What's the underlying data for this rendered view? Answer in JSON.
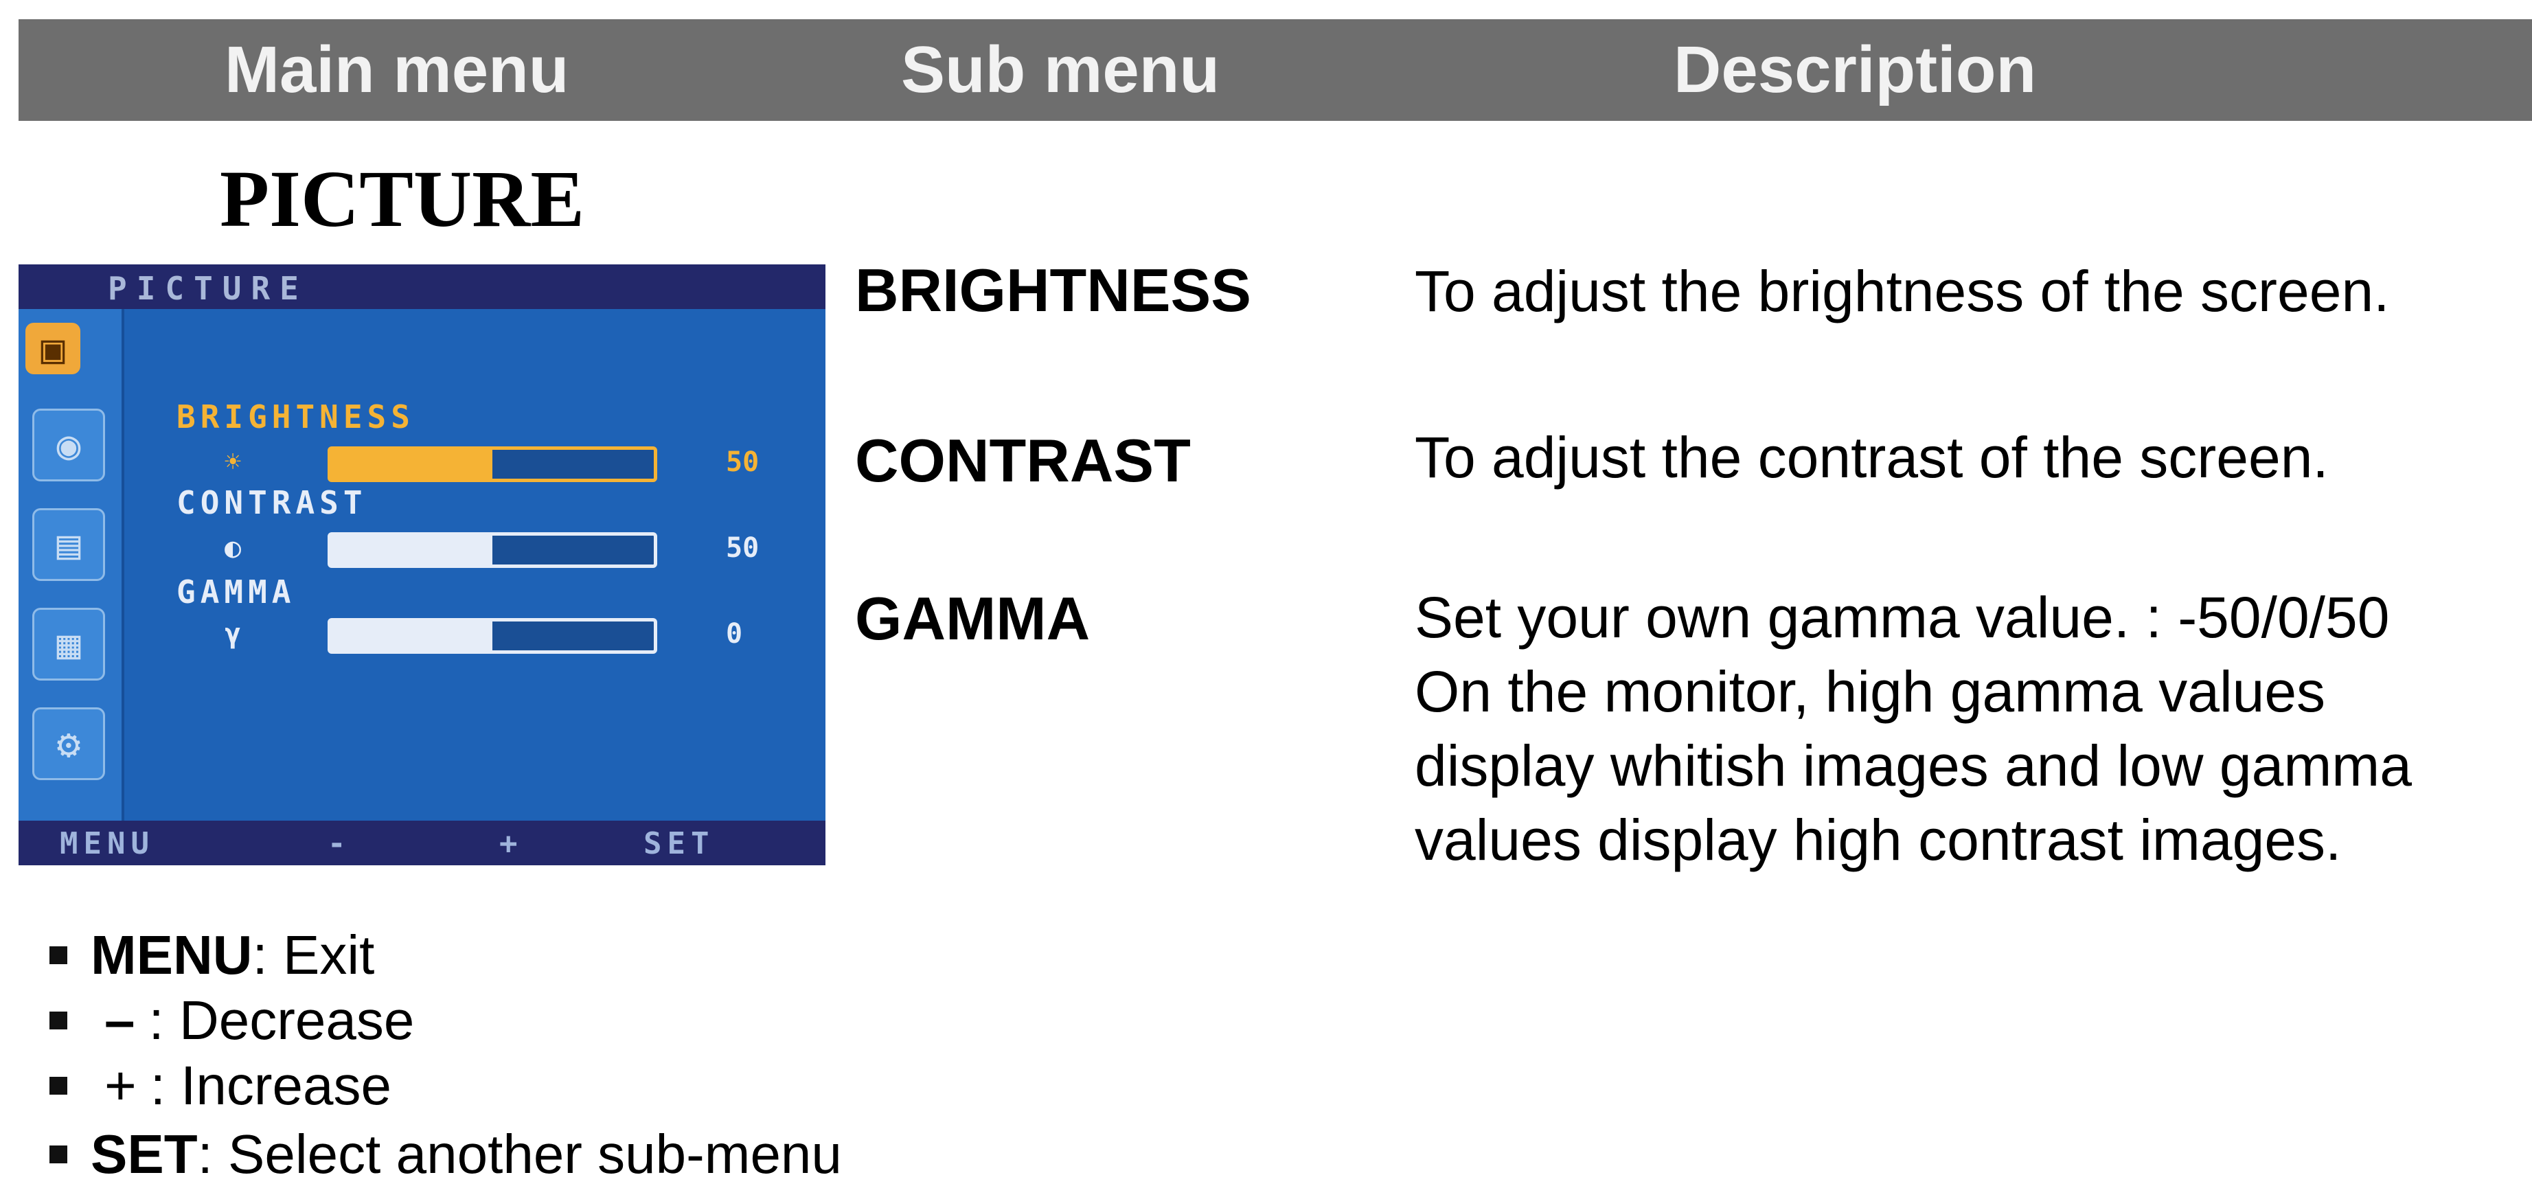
{
  "header": {
    "main_menu": "Main menu",
    "sub_menu": "Sub menu",
    "description": "Description"
  },
  "section_title": "PICTURE",
  "osd": {
    "title": "PICTURE",
    "items": [
      {
        "label": "BRIGHTNESS",
        "symbol": "☀",
        "value": "50",
        "level": 0.5,
        "selected": true
      },
      {
        "label": "CONTRAST",
        "symbol": "◐",
        "value": "50",
        "level": 0.5,
        "selected": false
      },
      {
        "label": "GAMMA",
        "symbol": "γ",
        "value": "0",
        "level": 0.5,
        "selected": false
      }
    ],
    "bottom": {
      "menu": "MENU",
      "minus": "-",
      "plus": "+",
      "set": "SET"
    },
    "colors": {
      "background": "#1e62b6",
      "selected": "#f5b335",
      "unselected": "#e6edf8"
    }
  },
  "submenus": [
    {
      "name": "BRIGHTNESS",
      "description": [
        "To adjust the brightness of the screen."
      ]
    },
    {
      "name": "CONTRAST",
      "description": [
        "To adjust the contrast of the screen."
      ]
    },
    {
      "name": "GAMMA",
      "description": [
        "Set your own gamma value. : -50/0/50",
        "On the monitor, high gamma values",
        "display whitish images and low gamma",
        "values display high contrast images."
      ]
    }
  ],
  "legend": [
    {
      "key": "MENU",
      "text": " : Exit"
    },
    {
      "key": "–",
      "text": " : Decrease"
    },
    {
      "key": "+",
      "text": " : Increase"
    },
    {
      "key": "SET",
      "text": " : Select another sub-menu"
    }
  ]
}
